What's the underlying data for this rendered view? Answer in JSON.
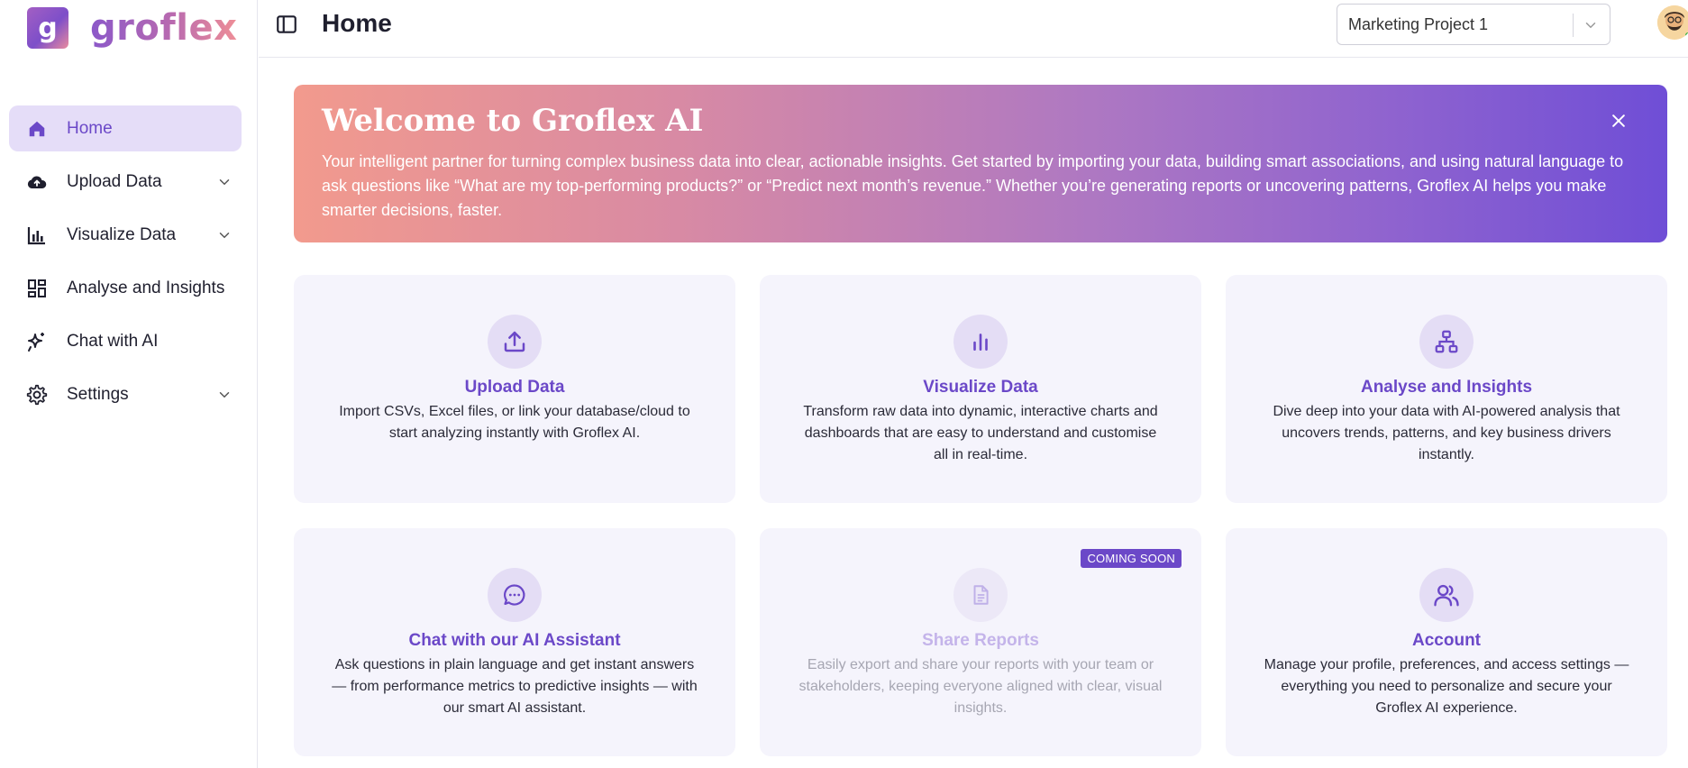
{
  "brand": {
    "logo_letter": "g",
    "name": "groflex"
  },
  "sidebar": {
    "items": [
      {
        "label": "Home",
        "icon": "home-icon",
        "active": true,
        "has_submenu": false
      },
      {
        "label": "Upload Data",
        "icon": "cloud-upload-icon",
        "active": false,
        "has_submenu": true
      },
      {
        "label": "Visualize Data",
        "icon": "bar-chart-icon",
        "active": false,
        "has_submenu": true
      },
      {
        "label": "Analyse and Insights",
        "icon": "dashboard-icon",
        "active": false,
        "has_submenu": false
      },
      {
        "label": "Chat with AI",
        "icon": "sparkle-icon",
        "active": false,
        "has_submenu": false
      },
      {
        "label": "Settings",
        "icon": "gear-icon",
        "active": false,
        "has_submenu": true
      }
    ]
  },
  "header": {
    "title": "Home",
    "project_select": {
      "value": "Marketing Project 1"
    }
  },
  "banner": {
    "title": "Welcome to Groflex AI",
    "text": "Your intelligent partner for turning complex business data into clear, actionable insights. Get started by importing your data, building smart associations, and using natural language to ask questions like “What are my top-performing products?” or “Predict next month’s revenue.” Whether you’re generating reports or uncovering patterns, Groflex AI helps you make smarter decisions, faster."
  },
  "cards": [
    {
      "title": "Upload Data",
      "description": "Import CSVs, Excel files, or link your database/cloud to start analyzing instantly with Groflex AI.",
      "icon": "upload-icon",
      "disabled": false,
      "badge": ""
    },
    {
      "title": "Visualize Data",
      "description": "Transform raw data into dynamic, interactive charts and dashboards that are easy to understand and customise all in real-time.",
      "icon": "bar-chart-icon",
      "disabled": false,
      "badge": ""
    },
    {
      "title": "Analyse and Insights",
      "description": "Dive deep into your data with AI-powered analysis that uncovers trends, patterns, and key business drivers instantly.",
      "icon": "hierarchy-icon",
      "disabled": false,
      "badge": ""
    },
    {
      "title": "Chat with our AI Assistant",
      "description": "Ask questions in plain language and get instant answers — from performance metrics to predictive insights — with our smart AI assistant.",
      "icon": "chat-bubble-icon",
      "disabled": false,
      "badge": ""
    },
    {
      "title": "Share Reports",
      "description": "Easily export and share your reports with your team or stakeholders, keeping everyone aligned with clear, visual insights.",
      "icon": "document-icon",
      "disabled": true,
      "badge": "COMING SOON"
    },
    {
      "title": "Account",
      "description": "Manage your profile, preferences, and access settings — everything you need to personalize and secure your Groflex AI experience.",
      "icon": "users-icon",
      "disabled": false,
      "badge": ""
    }
  ],
  "colors": {
    "accent": "#6b48c8",
    "active_bg": "#e5ddf8",
    "card_bg": "#f5f4fc",
    "icon_bg": "#e4ddf5"
  }
}
